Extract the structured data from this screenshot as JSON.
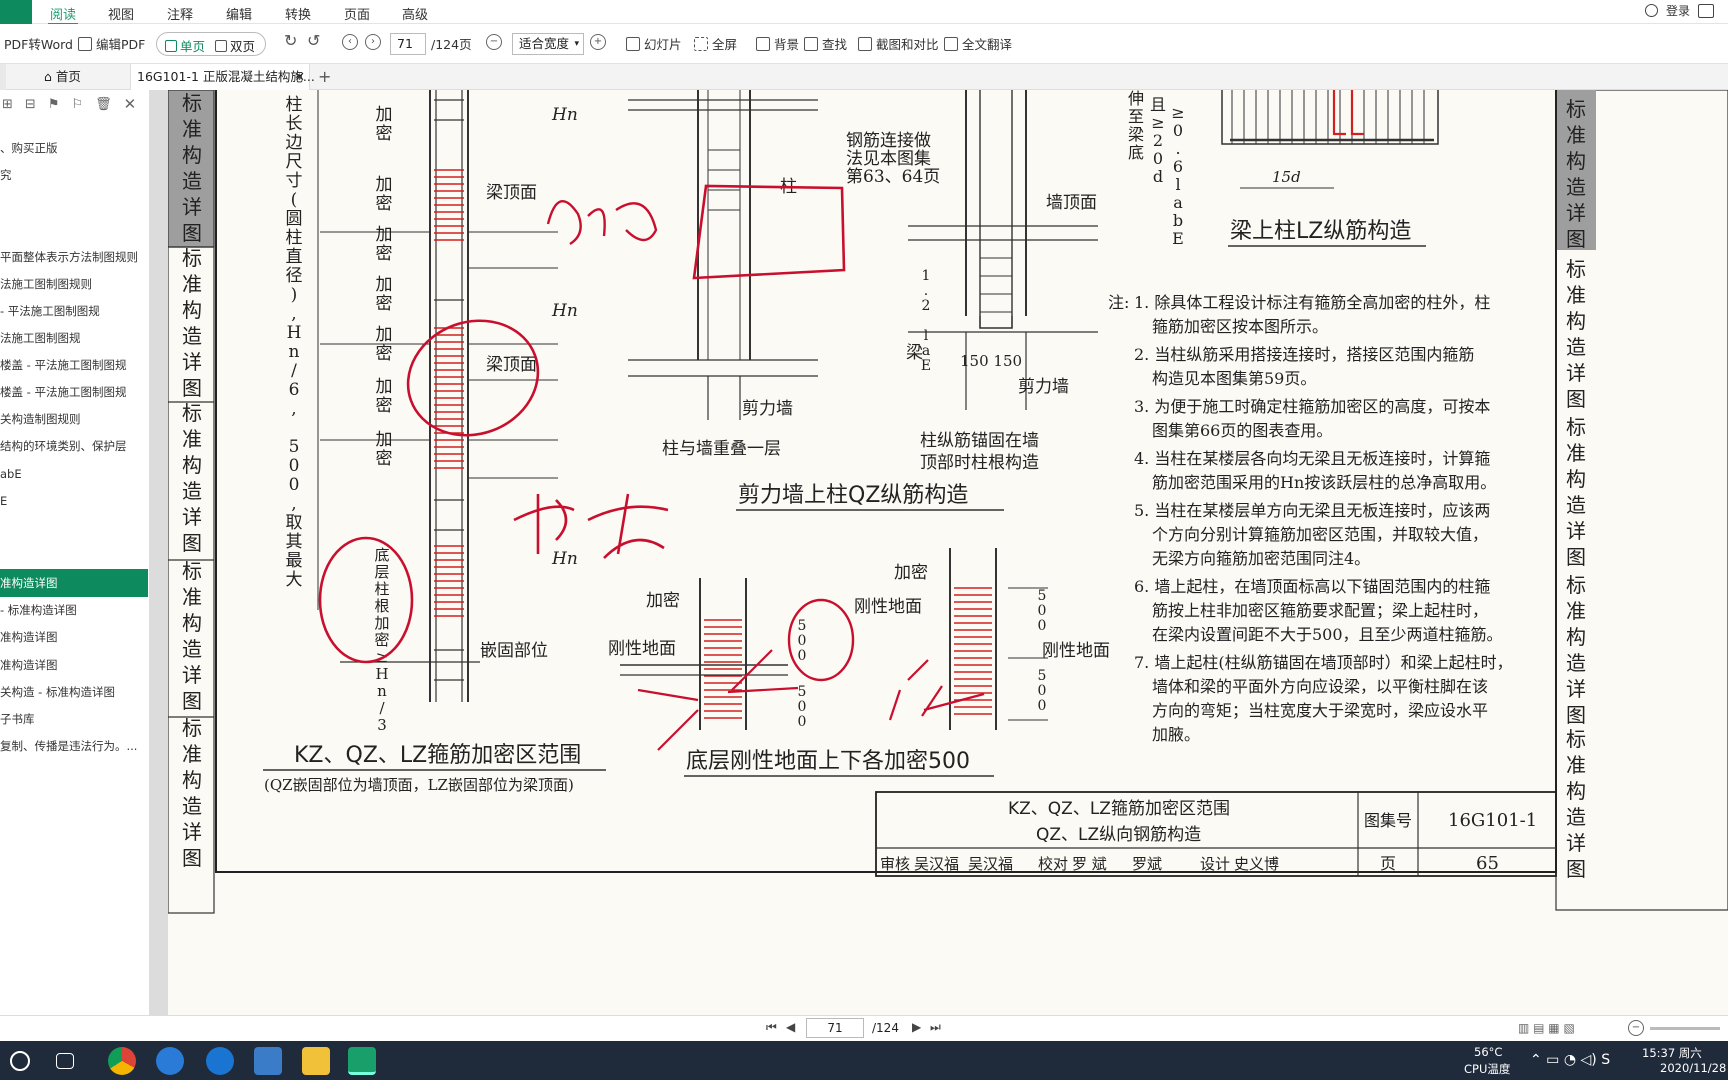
{
  "menubar": {
    "tabs": [
      "阅读",
      "视图",
      "注释",
      "编辑",
      "转换",
      "页面",
      "高级"
    ],
    "active": "阅读",
    "login": "登录"
  },
  "toolbar": {
    "pdf_to_word": "PDF转Word",
    "edit_pdf": "编辑PDF",
    "single": "单页",
    "double": "双页",
    "page_current": "71",
    "page_total": "/124页",
    "zoom": "适合宽度",
    "slideshow": "幻灯片",
    "fullscreen": "全屏",
    "background": "背景",
    "find": "查找",
    "compare": "截图和对比",
    "translate": "全文翻译"
  },
  "tabs": {
    "home": "首页",
    "doc": "16G101-1 正版混凝土结构施..."
  },
  "sidebar": {
    "items": [
      "、购买正版",
      "究",
      "平面整体表示方法制图规则",
      "法施工图制图规则",
      "- 平法施工图制图规",
      "法施工图制图规",
      "楼盖 - 平法施工图制图规",
      "楼盖 - 平法施工图制图规",
      "关构造制图规则",
      "结构的环境类别、保护层",
      "abE",
      "E",
      "准构造详图",
      "- 标准构造详图",
      "准构造详图",
      "准构造详图",
      "关构造 - 标准构造详图",
      "子书库",
      "复制、传播是违法行为。..."
    ],
    "selected_index": 12
  },
  "document": {
    "side_tab_left": [
      "标准构造详图",
      "标准构造详图",
      "标准构造详图",
      "标准构造详图",
      "标准构造详图"
    ],
    "left_vertical_text": "柱长边尺寸(圆柱直径),Hn/6, 500,取其最大",
    "jiami": "加密",
    "hn": "Hn",
    "liang_dingmian": "梁顶面",
    "qiangu_buwei": "嵌固部位",
    "diceng_zhugen": "底层柱根加密≥Hn/3",
    "fig1_title": "KZ、QZ、LZ箍筋加密区范围",
    "fig1_sub": "(QZ嵌固部位为墙顶面，LZ嵌固部位为梁顶面)",
    "zhu_yu_qiang": "柱与墙重叠一层",
    "jianliqiang": "剪力墙",
    "zhu_label": "柱",
    "connect_note": [
      "钢筋连接做",
      "法见本图集",
      "第63、64页"
    ],
    "qiang_dingmian": "墙顶面",
    "liang": "梁",
    "dim_1_2": "1.2 laE",
    "dim_150": "150 150",
    "anchor_title": [
      "柱纵筋锚固在墙",
      "顶部时柱根构造"
    ],
    "fig2_title": "剪力墙上柱QZ纵筋构造",
    "gangxing_dimian": "刚性地面",
    "dim_500": "500",
    "fig3_title": "底层刚性地面上下各加密500",
    "beam_col_title": "梁上柱LZ纵筋构造",
    "beam_dims": [
      "伸至梁底",
      "且≥20d",
      "≥0.6labE"
    ],
    "dim_15d": "15d",
    "notes_head": "注:",
    "notes": [
      "1. 除具体工程设计标注有箍筋全高加密的柱外，柱",
      "箍筋加密区按本图所示。",
      "2. 当柱纵筋采用搭接连接时，搭接区范围内箍筋",
      "构造见本图集第59页。",
      "3. 为便于施工时确定柱箍筋加密区的高度，可按本",
      "图集第66页的图表查用。",
      "4. 当柱在某楼层各向均无梁且无板连接时，计算箍",
      "筋加密范围采用的Hn按该跃层柱的总净高取用。",
      "5. 当柱在某楼层单方向无梁且无板连接时，应该两",
      "个方向分别计算箍筋加密区范围，并取较大值，",
      "无梁方向箍筋加密范围同注4。",
      "6. 墙上起柱，在墙顶面标高以下锚固范围内的柱箍",
      "筋按上柱非加密区箍筋要求配置；梁上起柱时，",
      "在梁内设置间距不大于500，且至少两道柱箍筋。",
      "7. 墙上起柱(柱纵筋锚固在墙顶部时）和梁上起柱时，",
      "墙体和梁的平面外方向应设梁，以平衡柱脚在该",
      "方向的弯矩；当柱宽度大于梁宽时，梁应设水平",
      "加腋。"
    ],
    "titleblock": {
      "title1": "KZ、QZ、LZ箍筋加密区范围",
      "title2": "QZ、LZ纵向钢筋构造",
      "atlas_label": "图集号",
      "atlas_no": "16G101-1",
      "page_label": "页",
      "page_no": "65",
      "row": [
        "审核",
        "吴汉福",
        "吴汉福",
        "校对",
        "罗 斌",
        "罗斌",
        "设计",
        "史义博"
      ]
    },
    "handwriting": [
      "加密",
      "搭接"
    ]
  },
  "statusbar": {
    "page_current": "71",
    "page_total": "/124"
  },
  "taskbar": {
    "temp": "56°C",
    "temp_label": "CPU温度",
    "time": "15:37 周六",
    "date": "2020/11/28"
  }
}
